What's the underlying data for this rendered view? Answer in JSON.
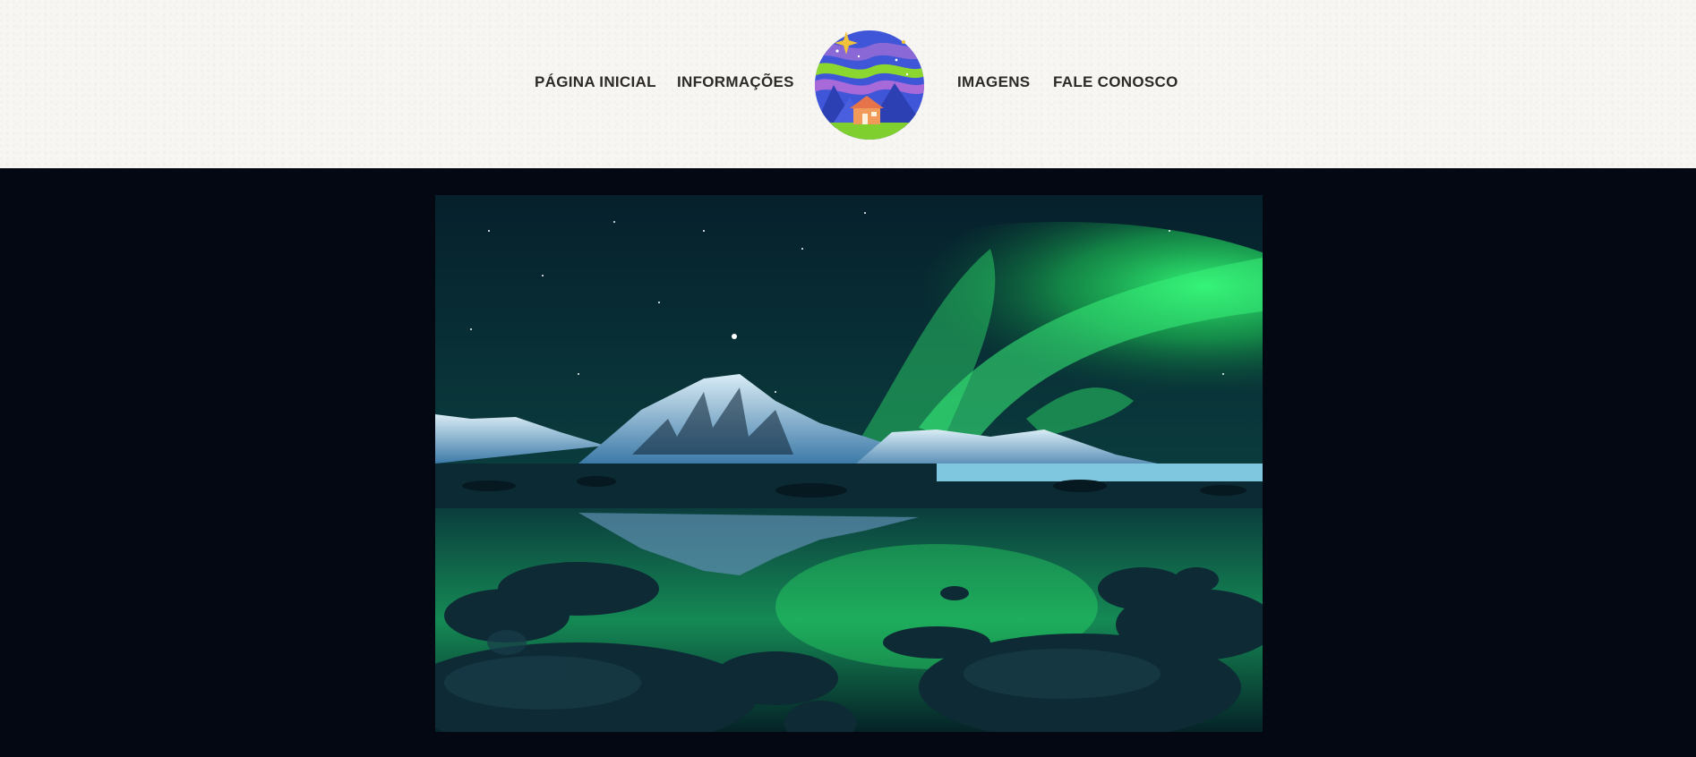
{
  "nav": {
    "left": [
      {
        "label": "PÁGINA INICIAL"
      },
      {
        "label": "INFORMAÇÕES"
      }
    ],
    "right": [
      {
        "label": "IMAGENS"
      },
      {
        "label": "FALE CONOSCO"
      }
    ]
  },
  "logo": {
    "icon": "aurora-cabin-logo-icon"
  },
  "hero": {
    "image": "aurora-borealis-mountain-lake-image"
  },
  "colors": {
    "header_bg": "#f7f6f2",
    "nav_text": "#2d2a26",
    "page_bg": "#030812",
    "aurora_green": "#2ef26a"
  }
}
